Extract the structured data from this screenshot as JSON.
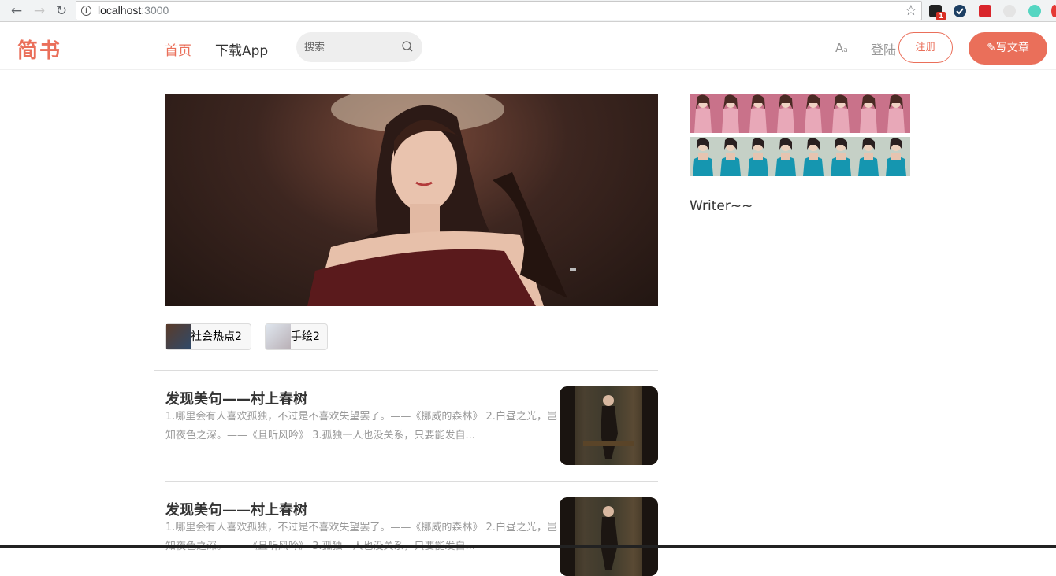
{
  "browser": {
    "url_host": "localhost",
    "url_port": ":3000",
    "extension_badge": "1"
  },
  "header": {
    "logo": "简书",
    "nav_home": "首页",
    "nav_app": "下载App",
    "search_placeholder": "搜索",
    "font_toggle": "A",
    "font_toggle_small": "a",
    "login": "登陆",
    "register": "注册",
    "write_label": "写文章"
  },
  "topics": [
    {
      "label": "社会热点2"
    },
    {
      "label": "手绘2"
    }
  ],
  "articles": [
    {
      "title": "发现美句——村上春树",
      "desc": "1.哪里会有人喜欢孤独，不过是不喜欢失望罢了。——《挪威的森林》 2.白昼之光，岂知夜色之深。——《且听风吟》 3.孤独一人也没关系，只要能发自..."
    },
    {
      "title": "发现美句——村上春树",
      "desc": "1.哪里会有人喜欢孤独，不过是不喜欢失望罢了。——《挪威的森林》 2.白昼之光，岂知夜色之深。——《且听风吟》 3.孤独一人也没关系，只要能发自..."
    }
  ],
  "sidebar": {
    "writer_heading": "Writer~~"
  },
  "colors": {
    "brand": "#ea6f5a",
    "muted_text": "#969696"
  }
}
